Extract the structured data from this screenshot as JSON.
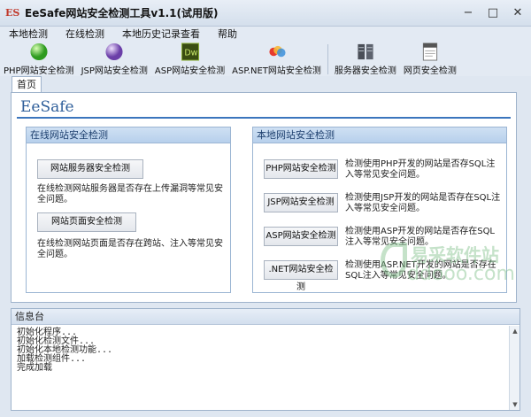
{
  "window": {
    "title": "EeSafe网站安全检测工具v1.1(试用版)",
    "logo_text": "ES",
    "min": "−",
    "max": "□",
    "close": "✕"
  },
  "menu": [
    "本地检测",
    "在线检测",
    "本地历史记录查看",
    "帮助"
  ],
  "toolbar": [
    {
      "label": "PHP网站安全检测",
      "icon": "php-globe-icon"
    },
    {
      "label": "JSP网站安全检测",
      "icon": "jsp-sphere-icon"
    },
    {
      "label": "ASP网站安全检测",
      "icon": "dreamweaver-icon"
    },
    {
      "label": "ASP.NET网站安全检测",
      "icon": "aspnet-icon"
    },
    {
      "label": "服务器安全检测",
      "icon": "server-icon"
    },
    {
      "label": "网页安全检测",
      "icon": "check-document-icon"
    }
  ],
  "tab": "首页",
  "brand": "EeSafe",
  "online": {
    "title": "在线网站安全检测",
    "server_button": "网站服务器安全检测",
    "server_desc": "在线检测网站服务器是否存在上传漏洞等常见安全问题。",
    "page_button": "网站页面安全检测",
    "page_desc": "在线检测网站页面是否存在跨站、注入等常见安全问题。"
  },
  "local": {
    "title": "本地网站安全检测",
    "items": [
      {
        "button": "PHP网站安全检测",
        "desc": "检测使用PHP开发的网站是否存SQL注入等常见安全问题。"
      },
      {
        "button": "JSP网站安全检测",
        "desc": "检测使用JSP开发的网站是否存在SQL注入等常见安全问题。"
      },
      {
        "button": "ASP网站安全检测",
        "desc": "检测使用ASP开发的网站是否存在SQL注入等常见安全问题。"
      },
      {
        "button": ".NET网站安全检测",
        "desc": "检测使用ASP.NET开发的网站是否存在SQL注入等常见安全问题。"
      }
    ]
  },
  "info": {
    "title": "信息台",
    "log": [
      "初始化程序...",
      "初始化检测文件...",
      "初始化本地检测功能...",
      "加载检测组件...",
      "完成加载"
    ]
  },
  "watermark": {
    "line1": "易采软件站",
    "line2": "ddooo.com"
  }
}
